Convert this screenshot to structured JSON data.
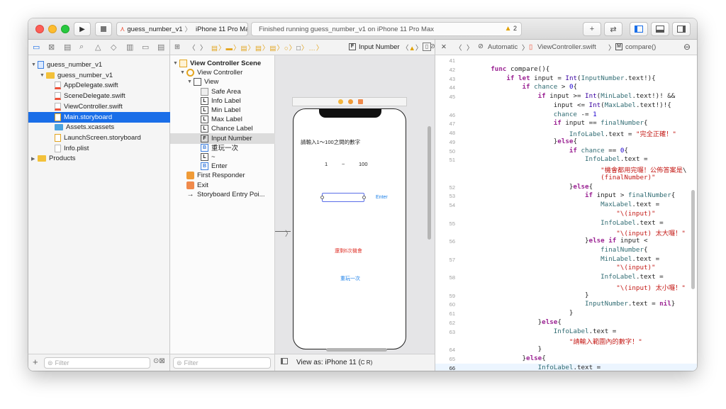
{
  "toolbar": {
    "scheme_target": "guess_number_v1",
    "scheme_device": "iPhone 11 Pro Max",
    "status_text": "Finished running guess_number_v1 on iPhone 11 Pro Max",
    "warning_count": "2",
    "plus": "+",
    "swap": "⇄"
  },
  "navigator": {
    "items": [
      {
        "label": "guess_number_v1",
        "kind": "project",
        "level": 0,
        "expanded": true
      },
      {
        "label": "guess_number_v1",
        "kind": "folder",
        "level": 1,
        "expanded": true
      },
      {
        "label": "AppDelegate.swift",
        "kind": "swift",
        "level": 2
      },
      {
        "label": "SceneDelegate.swift",
        "kind": "swift",
        "level": 2
      },
      {
        "label": "ViewController.swift",
        "kind": "swift",
        "level": 2
      },
      {
        "label": "Main.storyboard",
        "kind": "storyboard",
        "level": 2,
        "selected": true
      },
      {
        "label": "Assets.xcassets",
        "kind": "assets",
        "level": 2
      },
      {
        "label": "LaunchScreen.storyboard",
        "kind": "storyboard",
        "level": 2
      },
      {
        "label": "Info.plist",
        "kind": "plist",
        "level": 2
      },
      {
        "label": "Products",
        "kind": "folder",
        "level": 0,
        "collapsed": true
      }
    ],
    "filter_placeholder": "Filter"
  },
  "jumpbar": {
    "input_number": "Input Number"
  },
  "outline": {
    "items": [
      {
        "label": "View Controller Scene",
        "icon": "scene",
        "level": 0,
        "bold": true
      },
      {
        "label": "View Controller",
        "icon": "vc",
        "level": 1
      },
      {
        "label": "View",
        "icon": "view",
        "level": 2
      },
      {
        "label": "Safe Area",
        "icon": "safe",
        "level": 3
      },
      {
        "label": "Info Label",
        "icon": "L",
        "level": 3
      },
      {
        "label": "Min Label",
        "icon": "L",
        "level": 3
      },
      {
        "label": "Max Label",
        "icon": "L",
        "level": 3
      },
      {
        "label": "Chance Label",
        "icon": "L",
        "level": 3
      },
      {
        "label": "Input Number",
        "icon": "F",
        "level": 3,
        "selected": true
      },
      {
        "label": "重玩一次",
        "icon": "B",
        "level": 3
      },
      {
        "label": "~",
        "icon": "L",
        "level": 3
      },
      {
        "label": "Enter",
        "icon": "B",
        "level": 3
      },
      {
        "label": "First Responder",
        "icon": "responder",
        "level": 1
      },
      {
        "label": "Exit",
        "icon": "exit",
        "level": 1
      },
      {
        "label": "Storyboard Entry Poi...",
        "icon": "arrow",
        "level": 1
      }
    ],
    "filter_placeholder": "Filter"
  },
  "canvas": {
    "prompt": "請輸入1～100之間的數字",
    "min": "1",
    "tilde": "~",
    "max": "100",
    "enter": "Enter",
    "chance": "還剩6次機會",
    "replay": "重玩一次",
    "view_as": "View as: iPhone 11 (",
    "view_as_tail": "C  R)"
  },
  "editor": {
    "automatic": "Automatic",
    "file": "ViewController.swift",
    "func": "compare()",
    "current_line": 66,
    "lines": [
      {
        "n": "41",
        "t": ""
      },
      {
        "n": "42",
        "t": "        func compare(){"
      },
      {
        "n": "43",
        "t": "            if let input = Int(InputNumber.text!){"
      },
      {
        "n": "44",
        "t": "                if chance > 0{"
      },
      {
        "n": "45",
        "t": "                    if input >= Int(MinLabel.text!)! &&"
      },
      {
        "n": "",
        "t": "                        input <= Int(MaxLabel.text!)!{"
      },
      {
        "n": "46",
        "t": "                        chance -= 1"
      },
      {
        "n": "47",
        "t": "                        if input == finalNumber{"
      },
      {
        "n": "48",
        "t": "                            InfoLabel.text = \"完全正確！\""
      },
      {
        "n": "49",
        "t": "                        }else{"
      },
      {
        "n": "50",
        "t": "                            if chance == 0{"
      },
      {
        "n": "51",
        "t": "                                InfoLabel.text ="
      },
      {
        "n": "",
        "t": "                                    \"機會都用完囉！公佈答案是\\"
      },
      {
        "n": "",
        "t": "                                    (finalNumber)\""
      },
      {
        "n": "52",
        "t": "                            }else{"
      },
      {
        "n": "53",
        "t": "                                if input > finalNumber{"
      },
      {
        "n": "54",
        "t": "                                    MaxLabel.text ="
      },
      {
        "n": "",
        "t": "                                        \"\\(input)\""
      },
      {
        "n": "55",
        "t": "                                    InfoLabel.text ="
      },
      {
        "n": "",
        "t": "                                        \"\\(input) 太大囉！\""
      },
      {
        "n": "56",
        "t": "                                }else if input <"
      },
      {
        "n": "",
        "t": "                                    finalNumber{"
      },
      {
        "n": "57",
        "t": "                                    MinLabel.text ="
      },
      {
        "n": "",
        "t": "                                        \"\\(input)\""
      },
      {
        "n": "58",
        "t": "                                    InfoLabel.text ="
      },
      {
        "n": "",
        "t": "                                        \"\\(input) 太小囉！\""
      },
      {
        "n": "59",
        "t": "                                }"
      },
      {
        "n": "60",
        "t": "                                InputNumber.text = nil}"
      },
      {
        "n": "61",
        "t": "                            }"
      },
      {
        "n": "62",
        "t": "                    }else{"
      },
      {
        "n": "63",
        "t": "                        InfoLabel.text ="
      },
      {
        "n": "",
        "t": "                            \"請輸入範圍內的數字！\""
      },
      {
        "n": "64",
        "t": "                    }"
      },
      {
        "n": "65",
        "t": "                }else{"
      },
      {
        "n": "66",
        "t": "                    InfoLabel.text ="
      }
    ]
  },
  "colors": {
    "accent": "#1a6ee8",
    "keyword": "#9b2393",
    "string": "#c41a16",
    "number": "#1c00cf",
    "warning": "#e1a100"
  }
}
